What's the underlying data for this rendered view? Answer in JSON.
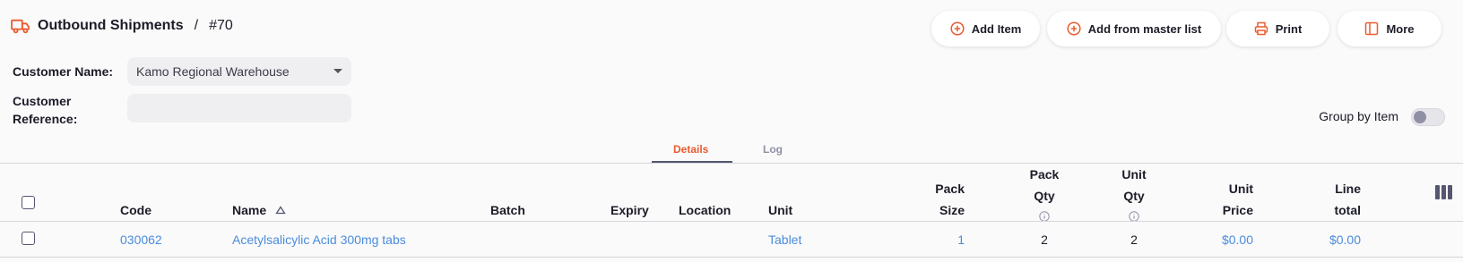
{
  "header": {
    "title": "Outbound Shipments",
    "separator": "/",
    "number": "#70"
  },
  "toolbar": {
    "add_item": "Add Item",
    "add_from_master": "Add from master list",
    "print": "Print",
    "more": "More"
  },
  "form": {
    "customer_name_label": "Customer Name:",
    "customer_name_value": "Kamo Regional Warehouse",
    "customer_reference_label_1": "Customer",
    "customer_reference_label_2": "Reference:",
    "customer_reference_value": ""
  },
  "group_by_item": {
    "label": "Group by Item",
    "enabled": false
  },
  "tabs": [
    {
      "label": "Details",
      "active": true
    },
    {
      "label": "Log",
      "active": false
    }
  ],
  "table": {
    "headers": {
      "code": "Code",
      "name": "Name",
      "batch": "Batch",
      "expiry": "Expiry",
      "location": "Location",
      "unit": "Unit",
      "pack_size_1": "Pack",
      "pack_size_2": "Size",
      "pack_qty_1": "Pack",
      "pack_qty_2": "Qty",
      "unit_qty_1": "Unit",
      "unit_qty_2": "Qty",
      "unit_price_1": "Unit",
      "unit_price_2": "Price",
      "line_total_1": "Line",
      "line_total_2": "total"
    },
    "rows": [
      {
        "code": "030062",
        "name": "Acetylsalicylic Acid 300mg tabs",
        "batch": "",
        "expiry": "",
        "location": "",
        "unit": "Tablet",
        "pack_size": "1",
        "pack_qty": "2",
        "unit_qty": "2",
        "unit_price": "$0.00",
        "line_total": "$0.00"
      }
    ]
  },
  "colors": {
    "accent": "#e95c30",
    "link": "#4a8cdb"
  }
}
